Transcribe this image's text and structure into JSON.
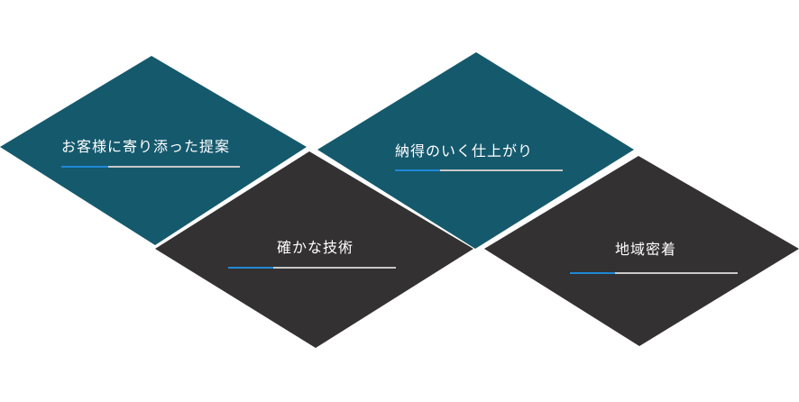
{
  "cards": [
    {
      "label": "お客様に寄り添った提案",
      "color": "#15596d"
    },
    {
      "label": "納得のいく仕上がり",
      "color": "#15596d"
    },
    {
      "label": "確かな技術",
      "color": "#333131"
    },
    {
      "label": "地域密着",
      "color": "#333131"
    }
  ],
  "accent_color": "#1e88d6",
  "underline_color": "#c8c8c8"
}
